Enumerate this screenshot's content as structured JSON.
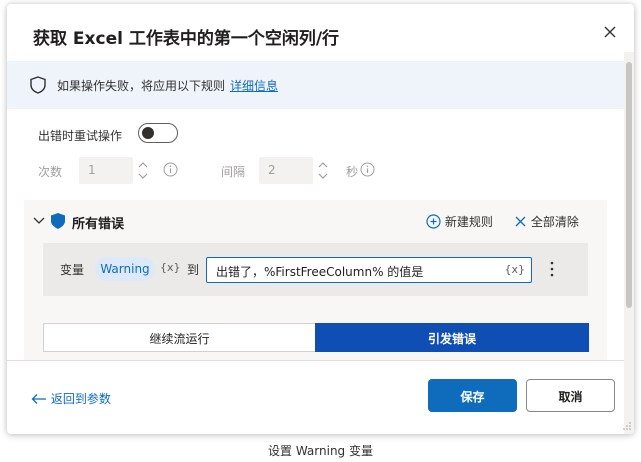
{
  "dialog": {
    "title": "获取 Excel 工作表中的第一个空闲列/行",
    "close_icon": "close-icon"
  },
  "info_bar": {
    "text": "如果操作失败，将应用以下规则",
    "link": "详细信息"
  },
  "retry": {
    "label": "出错时重试操作",
    "toggle_on": false,
    "count_label": "次数",
    "count_value": "1",
    "interval_label": "间隔",
    "interval_value": "2",
    "interval_unit": "秒"
  },
  "errors": {
    "title": "所有错误",
    "new_rule": "新建规则",
    "clear_all": "全部清除",
    "rule": {
      "var_label": "变量",
      "var_name": "Warning",
      "var_braces": "{x}",
      "to_label": "到",
      "value": "出错了，%FirstFreeColumn% 的值是",
      "value_braces": "{x}"
    },
    "segments": [
      "继续流运行",
      "引发错误"
    ],
    "selected_segment": 1
  },
  "footer": {
    "back": "返回到参数",
    "save": "保存",
    "cancel": "取消"
  },
  "caption": "设置 Warning 变量",
  "colors": {
    "accent": "#0f6cbd",
    "selected_segment": "#0f4fb3",
    "info_bg": "#eff4fb"
  }
}
